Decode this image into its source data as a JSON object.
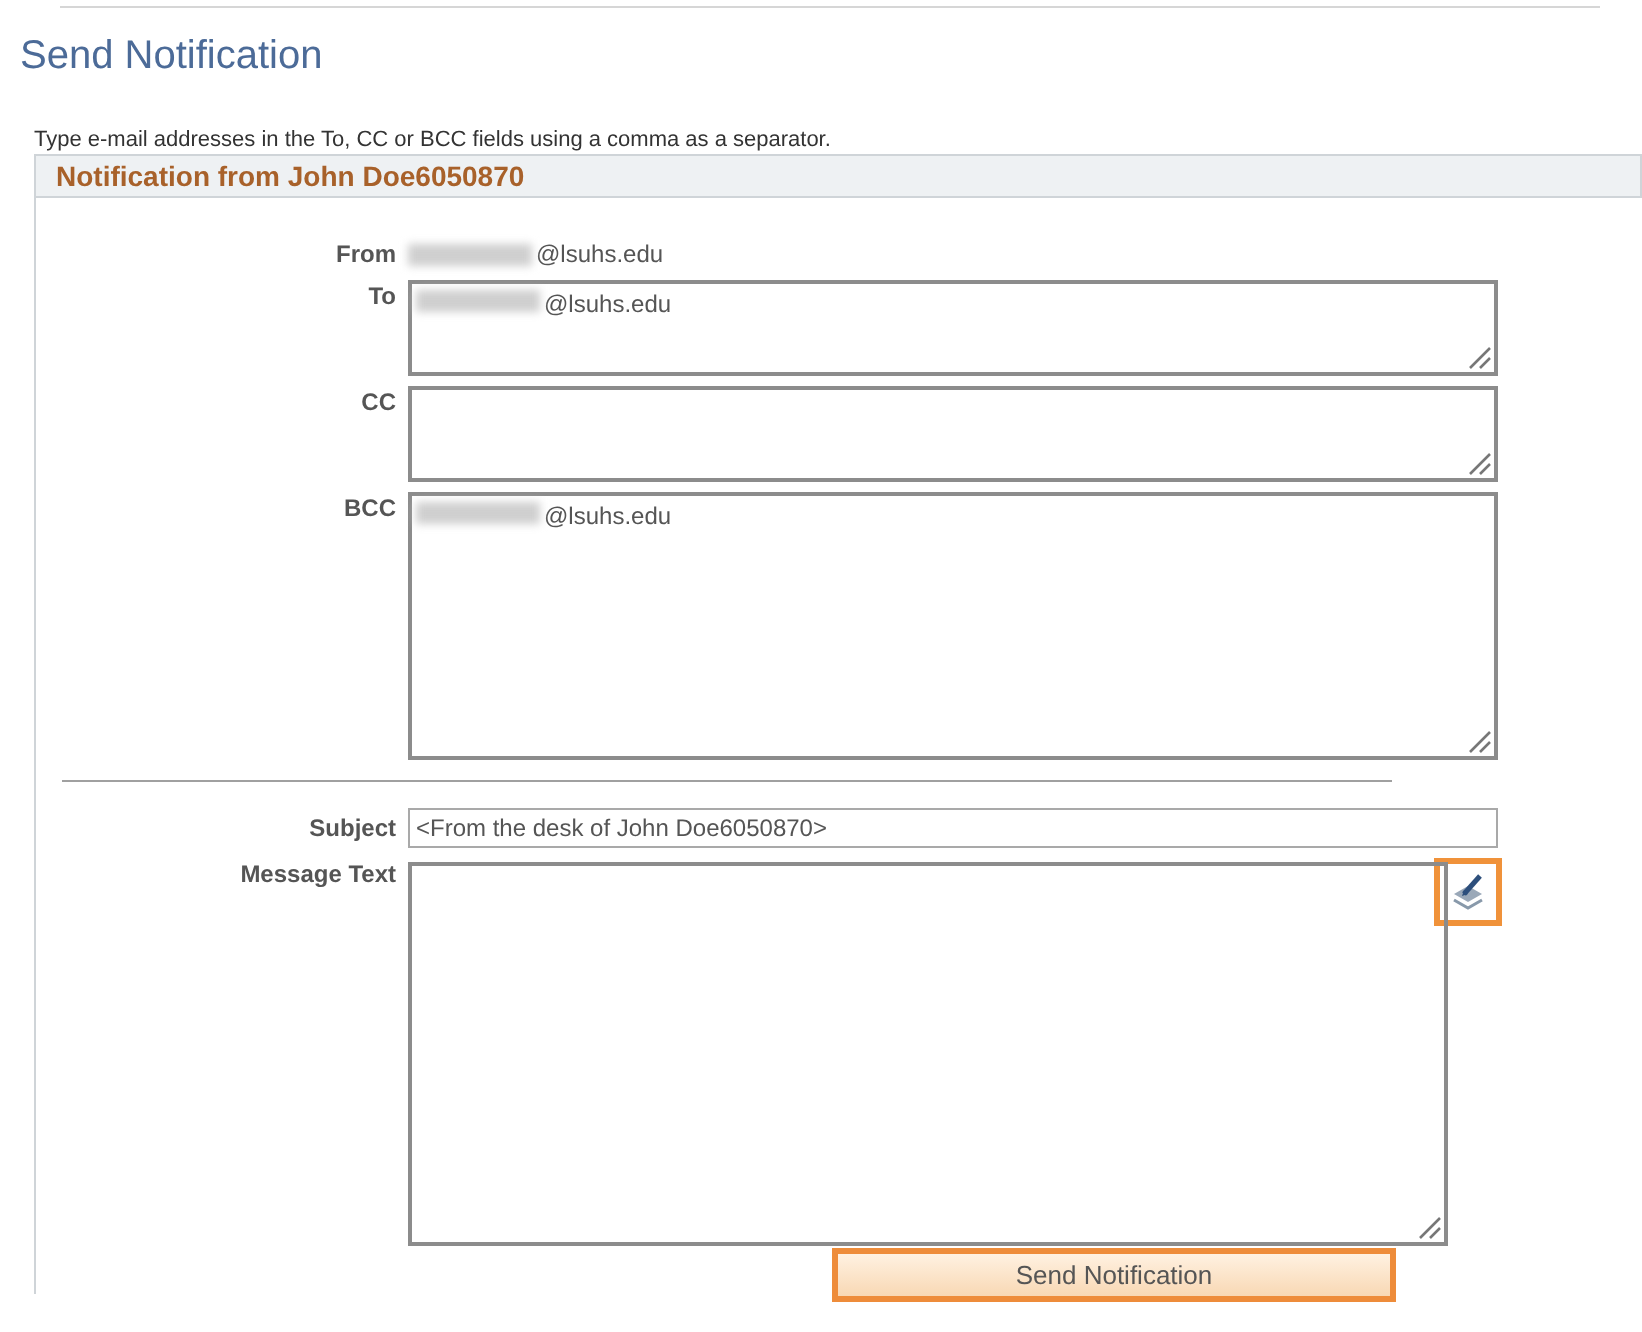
{
  "page_title": "Send Notification",
  "instructions": "Type e-mail addresses in the To, CC or BCC fields using a comma as a separator.",
  "section_title": "Notification from John Doe6050870",
  "from": {
    "label": "From",
    "value": "@lsuhs.edu",
    "redacted": true
  },
  "recipients": [
    {
      "label": "To",
      "value": "@lsuhs.edu",
      "redacted": true,
      "kind": "short"
    },
    {
      "label": "CC",
      "kind": "short"
    },
    {
      "label": "BCC",
      "value": "@lsuhs.edu",
      "redacted": true,
      "kind": "tall"
    }
  ],
  "subject": {
    "label": "Subject",
    "value": "<From the desk of John Doe6050870>"
  },
  "message": {
    "label": "Message Text"
  },
  "send_button": "Send Notification"
}
